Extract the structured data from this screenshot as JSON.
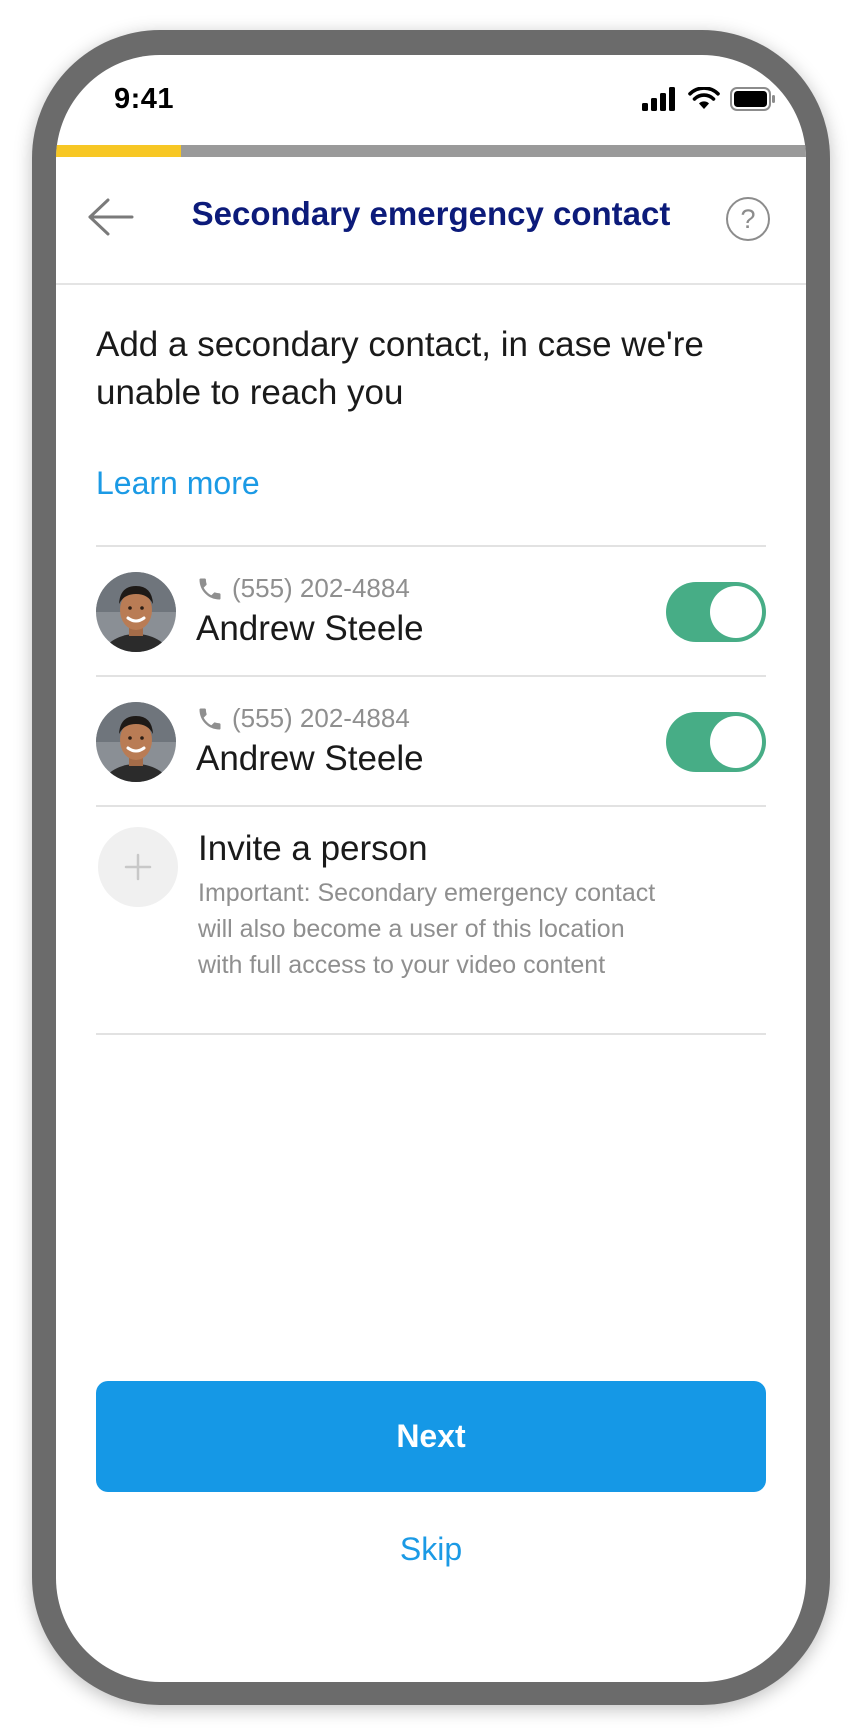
{
  "status_bar": {
    "time": "9:41"
  },
  "progress": {
    "fraction": 0.166,
    "fill_color": "#f7c724",
    "track_color": "#9a9a9a"
  },
  "header": {
    "title": "Secondary emergency contact",
    "back_icon": "arrow-left-icon",
    "help_icon": "question-circle-icon",
    "help_glyph": "?"
  },
  "intro": {
    "text": "Add a secondary contact, in case we're unable to reach you",
    "learn_more": "Learn more"
  },
  "contacts": [
    {
      "phone": "(555) 202-4884",
      "name": "Andrew Steele",
      "enabled": true
    },
    {
      "phone": "(555) 202-4884",
      "name": "Andrew Steele",
      "enabled": true
    }
  ],
  "invite": {
    "title": "Invite a person",
    "note": "Important: Secondary emergency contact will also become a user of this location with full access to your video content"
  },
  "actions": {
    "next_label": "Next",
    "skip_label": "Skip"
  },
  "colors": {
    "title": "#0c1b7a",
    "accent": "#1b9ae5",
    "button": "#1598e6",
    "toggle_on": "#47ad86"
  }
}
